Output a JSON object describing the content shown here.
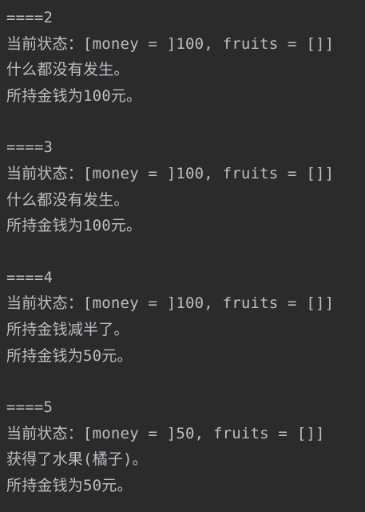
{
  "console": {
    "blocks": [
      {
        "header": "====2",
        "state": "当前状态：[money = ]100, fruits = []]",
        "event": "什么都没有发生。",
        "money": "所持金钱为100元。"
      },
      {
        "header": "====3",
        "state": "当前状态：[money = ]100, fruits = []]",
        "event": "什么都没有发生。",
        "money": "所持金钱为100元。"
      },
      {
        "header": "====4",
        "state": "当前状态：[money = ]100, fruits = []]",
        "event": "所持金钱减半了。",
        "money": "所持金钱为50元。"
      },
      {
        "header": "====5",
        "state": "当前状态：[money = ]50, fruits = []]",
        "event": "获得了水果(橘子)。",
        "money": "所持金钱为50元。"
      }
    ]
  },
  "colors": {
    "background": "#2b2b2b",
    "text": "#bcbec4"
  }
}
